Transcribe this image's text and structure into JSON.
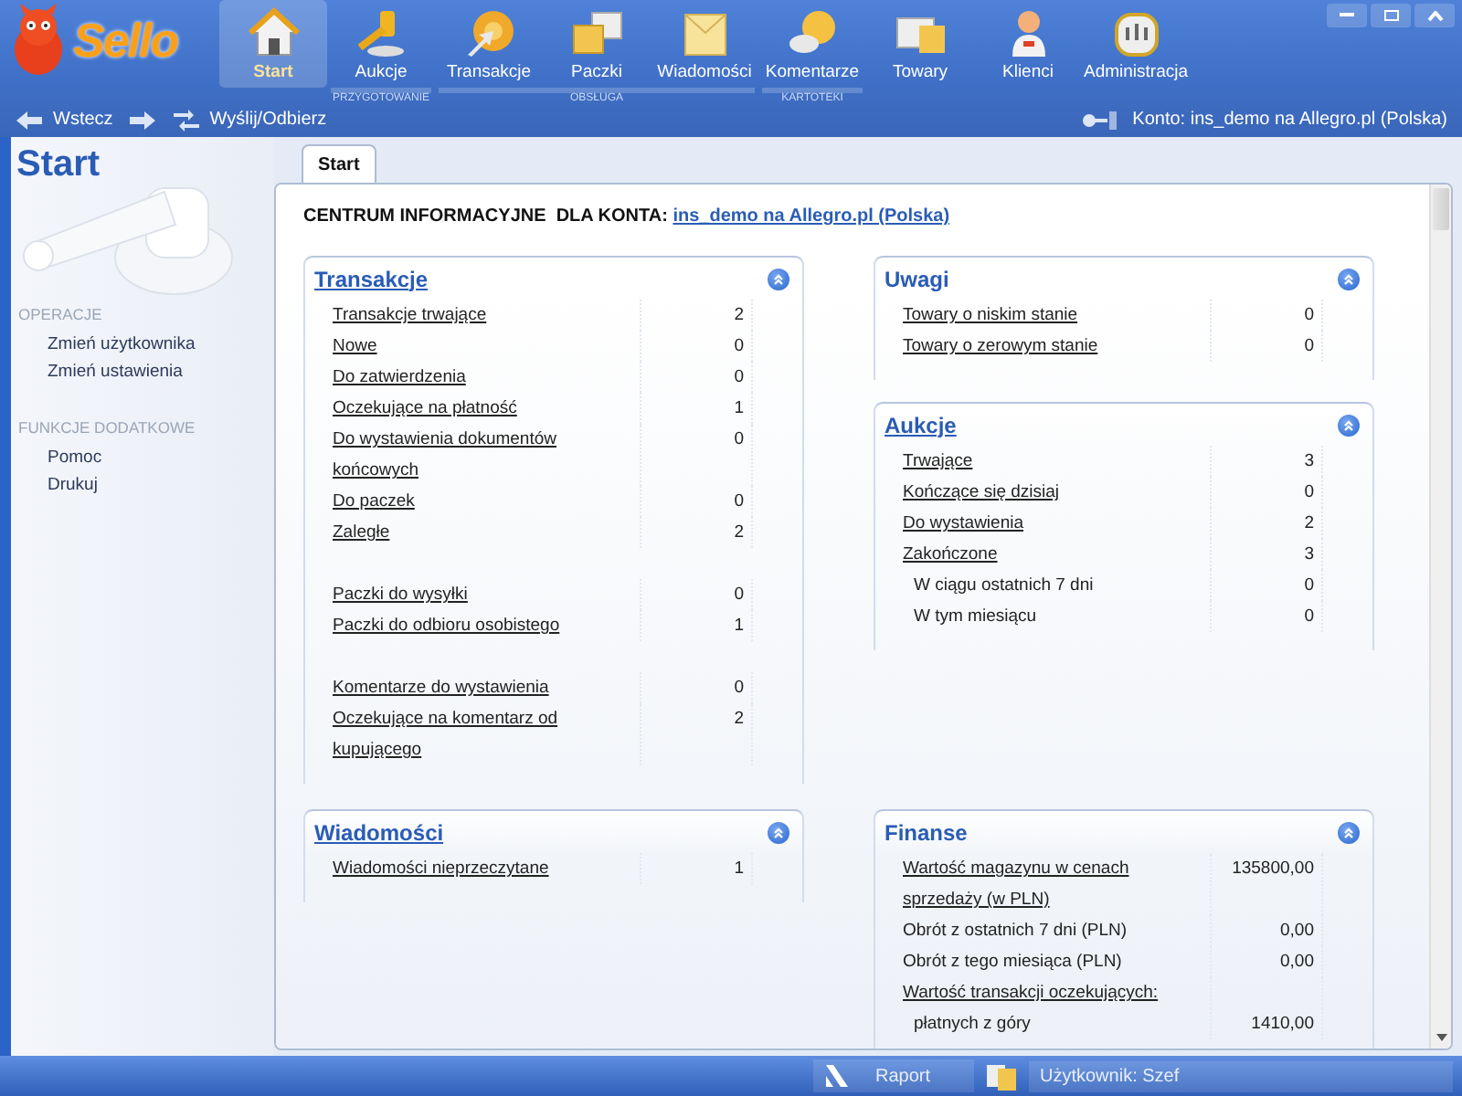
{
  "app": {
    "logo": "Sello"
  },
  "toolbar": {
    "groups": [
      {
        "items": [
          {
            "label": "Start",
            "selected": true
          }
        ]
      },
      {
        "label": "PRZYGOTOWANIE",
        "items": [
          {
            "label": "Aukcje",
            "selected": false
          }
        ]
      },
      {
        "label": "OBSŁUGA",
        "items": [
          {
            "label": "Transakcje",
            "selected": false
          },
          {
            "label": "Paczki",
            "selected": false
          },
          {
            "label": "Wiadomości",
            "selected": false
          }
        ]
      },
      {
        "label": "KARTOTEKI",
        "items": [
          {
            "label": "Komentarze",
            "selected": false
          }
        ]
      },
      {
        "items": [
          {
            "label": "Towary",
            "selected": false
          },
          {
            "label": "Klienci",
            "selected": false
          },
          {
            "label": "Administracja",
            "selected": false
          }
        ]
      }
    ]
  },
  "nav": {
    "back": "Wstecz",
    "send_receive": "Wyślij/Odbierz",
    "account": "Konto: ins_demo na Allegro.pl (Polska)"
  },
  "sidebar": {
    "title": "Start",
    "sections": [
      {
        "heading": "OPERACJE",
        "items": [
          "Zmień użytkownika",
          "Zmień ustawienia"
        ]
      },
      {
        "heading": "FUNKCJE DODATKOWE",
        "items": [
          "Pomoc",
          "Drukuj"
        ]
      }
    ]
  },
  "tabs": [
    {
      "label": "Start",
      "selected": true
    }
  ],
  "heading": {
    "label": "CENTRUM INFORMACYJNE  DLA KONTA:",
    "link": "ins_demo na Allegro.pl (Polska)"
  },
  "section_rows": [
    {
      "columns": [
        [
          {
            "title": "Transakcje",
            "title_link": true,
            "groups": [
              [
                {
                  "kind": "link",
                  "label": "Transakcje trwające",
                  "value": "2"
                },
                {
                  "kind": "link",
                  "label": "Nowe",
                  "value": "0"
                },
                {
                  "kind": "link",
                  "label": "Do zatwierdzenia",
                  "value": "0"
                },
                {
                  "kind": "link",
                  "label": "Oczekujące na płatność",
                  "value": "1"
                },
                {
                  "kind": "link",
                  "label": "Do wystawienia dokumentów końcowych",
                  "value": "0"
                },
                {
                  "kind": "link",
                  "label": "Do paczek",
                  "value": "0"
                },
                {
                  "kind": "link",
                  "label": "Zaległe",
                  "value": "2"
                }
              ],
              [
                {
                  "kind": "link",
                  "label": "Paczki do wysyłki",
                  "value": "0"
                },
                {
                  "kind": "link",
                  "label": "Paczki do odbioru osobistego",
                  "value": "1"
                }
              ],
              [
                {
                  "kind": "link",
                  "label": "Komentarze do wystawienia",
                  "value": "0"
                },
                {
                  "kind": "link",
                  "label": "Oczekujące na komentarz od kupującego",
                  "value": "2"
                }
              ]
            ]
          }
        ],
        [
          {
            "title": "Uwagi",
            "title_link": false,
            "groups": [
              [
                {
                  "kind": "link",
                  "label": "Towary o niskim stanie",
                  "value": "0"
                },
                {
                  "kind": "link",
                  "label": "Towary o zerowym stanie",
                  "value": "0"
                }
              ]
            ]
          },
          {
            "title": "Aukcje",
            "title_link": true,
            "groups": [
              [
                {
                  "kind": "link",
                  "label": "Trwające",
                  "value": "3"
                },
                {
                  "kind": "link",
                  "label": "Kończące się dzisiaj",
                  "value": "0"
                },
                {
                  "kind": "link",
                  "label": "Do wystawienia",
                  "value": "2"
                },
                {
                  "kind": "link",
                  "label": "Zakończone",
                  "value": "3"
                },
                {
                  "kind": "subtext",
                  "label": "W ciągu ostatnich 7 dni",
                  "value": "0"
                },
                {
                  "kind": "subtext",
                  "label": "W tym miesiącu",
                  "value": "0"
                }
              ]
            ]
          }
        ]
      ]
    },
    {
      "columns": [
        [
          {
            "title": "Wiadomości",
            "title_link": true,
            "groups": [
              [
                {
                  "kind": "link",
                  "label": "Wiadomości nieprzeczytane",
                  "value": "1"
                }
              ]
            ]
          }
        ],
        [
          {
            "title": "Finanse",
            "title_link": false,
            "groups": [
              [
                {
                  "kind": "link",
                  "label": "Wartość magazynu w cenach sprzedaży (w PLN)",
                  "value": "135800,00"
                },
                {
                  "kind": "text",
                  "label": "Obrót z ostatnich 7 dni (PLN)",
                  "value": "0,00"
                },
                {
                  "kind": "text",
                  "label": "Obrót z tego miesiąca (PLN)",
                  "value": "0,00"
                },
                {
                  "kind": "link",
                  "label": "Wartość transakcji oczekujących:"
                },
                {
                  "kind": "subtext",
                  "label": "płatnych z góry",
                  "value": "1410,00"
                }
              ]
            ]
          }
        ]
      ]
    }
  ],
  "status_bar": {
    "report": "Raport",
    "user": "Użytkownik: Szef"
  }
}
